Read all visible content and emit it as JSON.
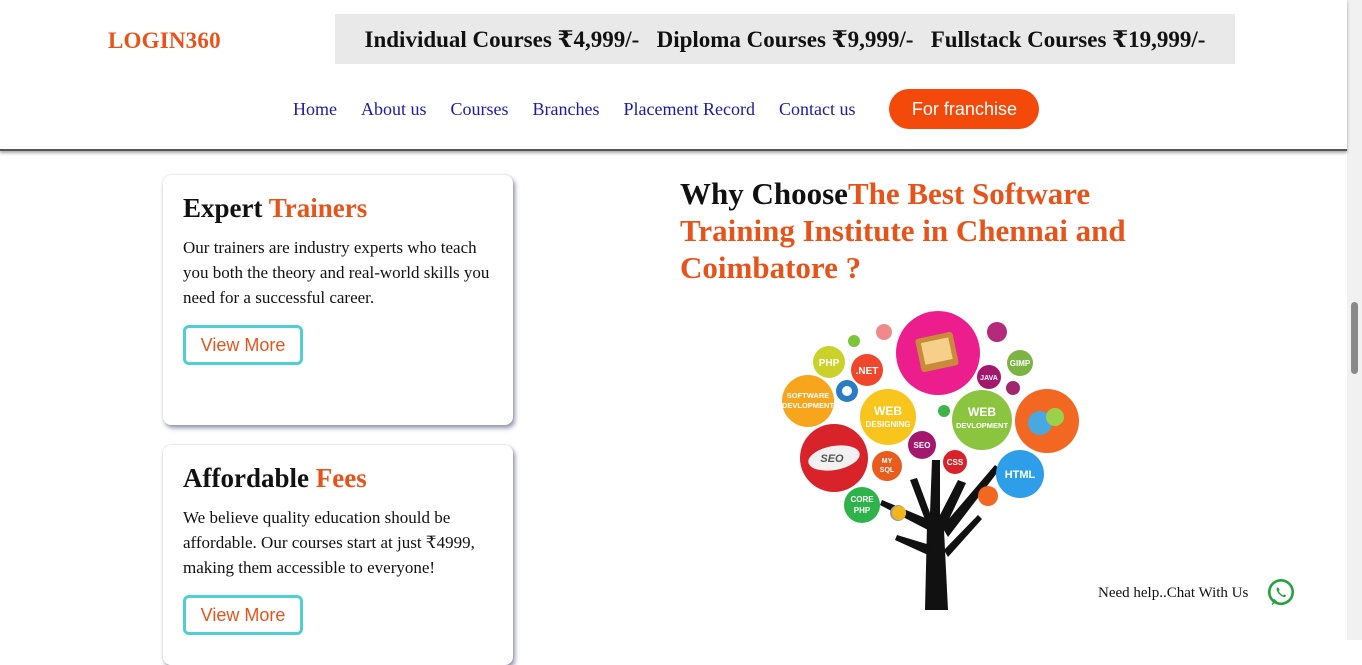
{
  "header": {
    "logo": "LOGIN360",
    "price_banner": [
      "Individual Courses ₹4,999/-",
      "Diploma Courses ₹9,999/-",
      "Fullstack Courses ₹19,999/-"
    ],
    "nav": [
      "Home",
      "About us",
      "Courses",
      "Branches",
      "Placement Record",
      "Contact us"
    ],
    "cta_label": "For franchise"
  },
  "cards": [
    {
      "title": "Expert",
      "title_accent": "Trainers",
      "body": "Our trainers are industry experts who teach you both the theory and real-world skills you need for a successful career.",
      "button": "View More"
    },
    {
      "title": "Affordable",
      "title_accent": "Fees",
      "body": "We believe quality education should be affordable. Our courses start at just ₹4999, making them accessible to everyone!",
      "button": "View More"
    }
  ],
  "why": {
    "lead": "Why Choose",
    "accent": "The Best Software Training Institute in Chennai and Coimbatore ?"
  },
  "tree_labels": {
    "php": "PHP",
    "net": ".NET",
    "software_dev": [
      "SOFTWARE",
      "DEVLOPMENT"
    ],
    "web_designing": [
      "WEB",
      "DESIGNING"
    ],
    "web_devlopment": [
      "WEB",
      "DEVLOPMENT"
    ],
    "gimp": "GIMP",
    "java": "JAVA",
    "seo_small": "SEO",
    "seo_big": "SEO",
    "css": "CSS",
    "html": "HTML",
    "mysql": [
      "MY",
      "SQL"
    ],
    "core_php": [
      "CORE",
      "PHP"
    ]
  },
  "chat": {
    "label": "Need help..Chat With Us"
  },
  "colors": {
    "accent": "#e8531a",
    "nav_link": "#1a1aa8",
    "cta": "#f34a0c",
    "button_border": "#4fcfd3",
    "banner_bg": "#e9e9e9",
    "whatsapp": "#25a244"
  }
}
